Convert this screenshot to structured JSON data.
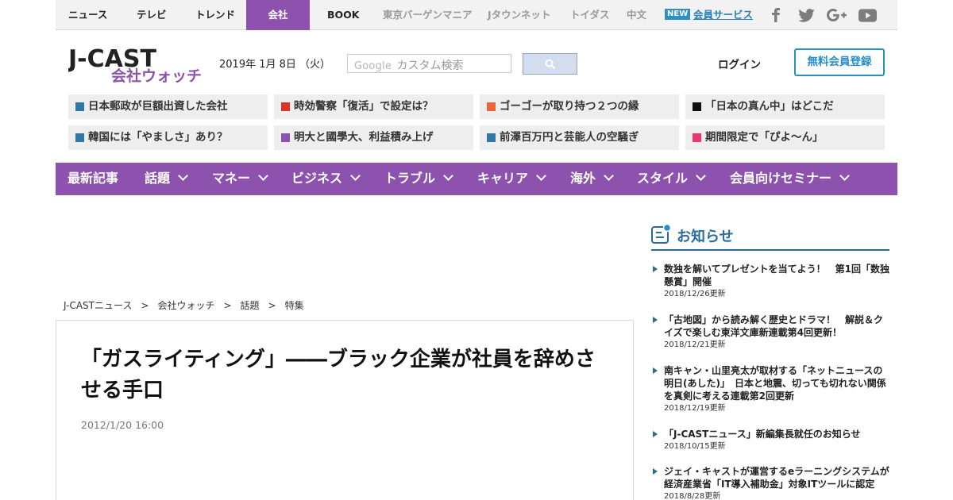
{
  "topnav": {
    "items": [
      "ニュース",
      "テレビ",
      "トレンド",
      "会社",
      "BOOK"
    ],
    "active": "会社",
    "sub_items": [
      "東京バーゲンマニア",
      "Jタウンネット",
      "トイダス",
      "中文"
    ],
    "new_badge": "NEW",
    "member_link": "会員サービス",
    "social_icons": [
      "facebook-icon",
      "twitter-icon",
      "google-plus-icon",
      "youtube-icon"
    ]
  },
  "header": {
    "logo_main": "J-CAST",
    "logo_sub": "会社ウォッチ",
    "date": "2019年 1月 8日 （火）",
    "search_brand": "Google",
    "search_placeholder": "カスタム検索",
    "login": "ログイン",
    "register": "無料会員登録"
  },
  "pickups": [
    {
      "text": "日本郵政が巨額出資した会社",
      "color": "#2f78a8"
    },
    {
      "text": "時効警察「復活」で設定は？",
      "color": "#d9342b"
    },
    {
      "text": "ゴーゴーが取り持つ２つの縁",
      "color": "#f0643c"
    },
    {
      "text": "「日本の真ん中」はどこだ",
      "color": "#111111"
    },
    {
      "text": "韓国には「やましさ」あり？",
      "color": "#2f78a8"
    },
    {
      "text": "明大と國學大、利益積み上げ",
      "color": "#8c52ad"
    },
    {
      "text": "前澤百万円と芸能人の空騒ぎ",
      "color": "#2f78a8"
    },
    {
      "text": "期間限定で「ぴよ～ん」",
      "color": "#e8386e"
    }
  ],
  "catnav": [
    "最新記事",
    "話題",
    "マネー",
    "ビジネス",
    "トラブル",
    "キャリア",
    "海外",
    "スタイル",
    "会員向けセミナー"
  ],
  "breadcrumb": [
    "J-CASTニュース",
    "会社ウォッチ",
    "話題",
    "特集"
  ],
  "breadcrumb_sep": ">",
  "article": {
    "title": "「ガスライティング」――ブラック企業が社員を辞めさせる手口",
    "date": "2012/1/20 16:00"
  },
  "sidebar": {
    "title": "お知らせ",
    "items": [
      {
        "title": "数独を解いてプレゼントを当てよう！　第1回「数独懸賞」開催",
        "date": "2018/12/26更新"
      },
      {
        "title": "「古地図」から読み解く歴史とドラマ！　解説＆クイズで楽しむ東洋文庫新連載第4回更新！",
        "date": "2018/12/21更新"
      },
      {
        "title": "南キャン・山里亮太が取材する「ネットニュースの明日(あした)」　日本と地震、切っても切れない関係を真剣に考える連載第2回更新",
        "date": "2018/12/19更新"
      },
      {
        "title": "「J-CASTニュース」新編集長就任のお知らせ",
        "date": "2018/10/15更新"
      },
      {
        "title": "ジェイ・キャストが運営するeラーニングシステムが経済産業省「IT導入補助金」対象ITツールに認定",
        "date": "2018/8/28更新"
      }
    ]
  },
  "colors": {
    "purple": "#8c52ad",
    "blue": "#2a8fc4",
    "navy": "#2a6c99"
  }
}
